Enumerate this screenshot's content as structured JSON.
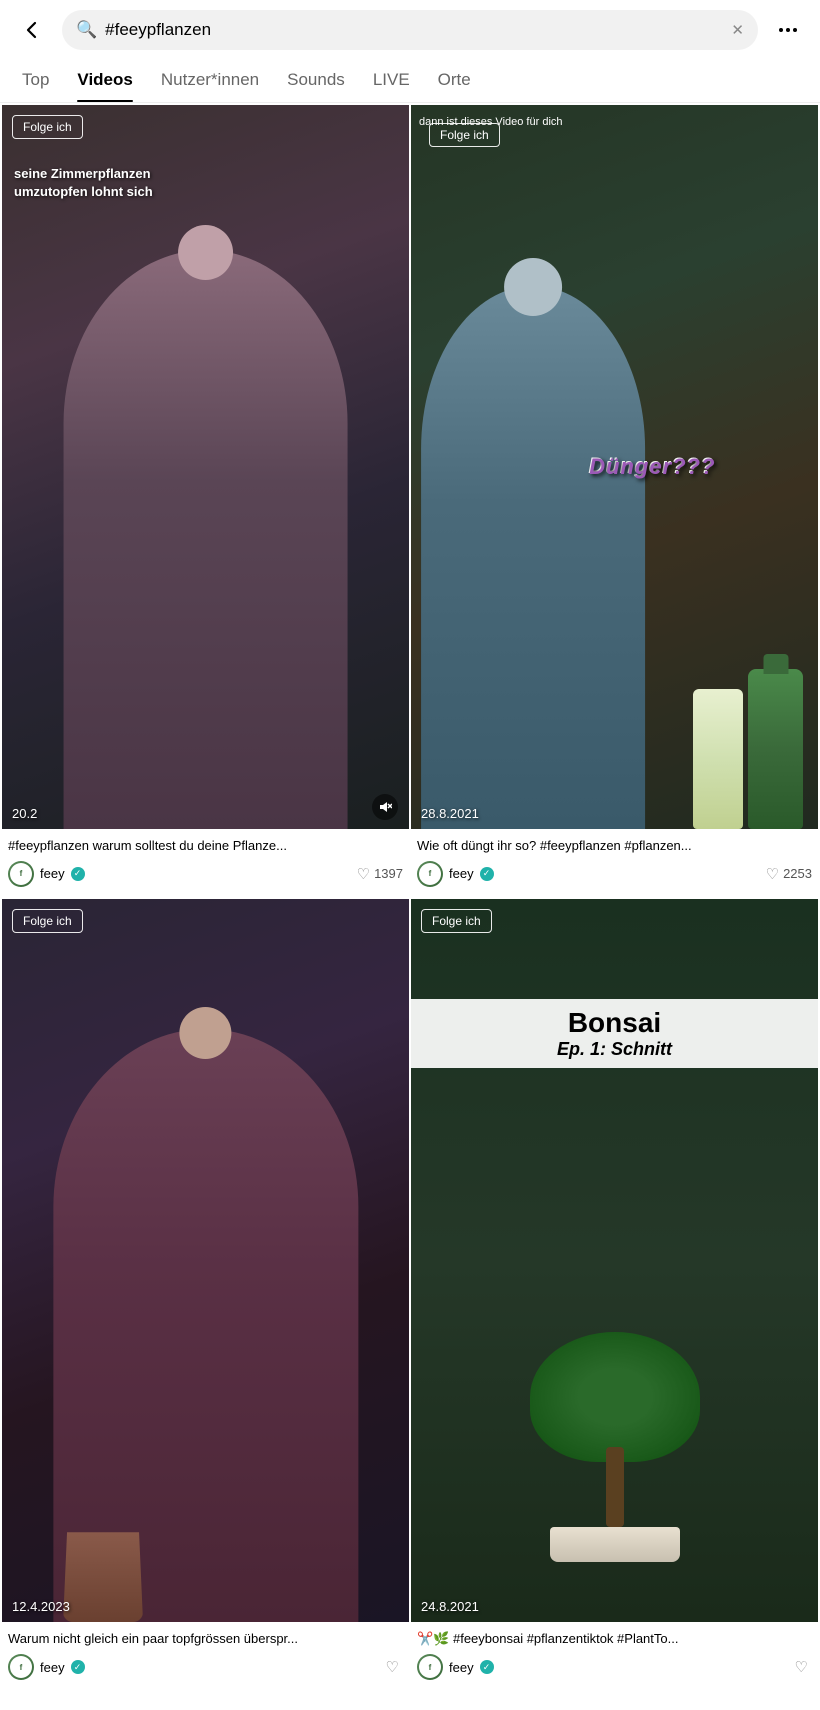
{
  "header": {
    "search_query": "#feeypflanzen",
    "back_label": "back",
    "clear_label": "clear",
    "more_label": "more"
  },
  "tabs": [
    {
      "id": "top",
      "label": "Top",
      "active": false
    },
    {
      "id": "videos",
      "label": "Videos",
      "active": true
    },
    {
      "id": "nutzerinnen",
      "label": "Nutzer*innen",
      "active": false
    },
    {
      "id": "sounds",
      "label": "Sounds",
      "active": false
    },
    {
      "id": "live",
      "label": "LIVE",
      "active": false
    },
    {
      "id": "orte",
      "label": "Orte",
      "active": false
    }
  ],
  "videos": [
    {
      "id": "v1",
      "timestamp": "20.2",
      "caption": "#feeypflanzen warum solltest du deine Pflanze...",
      "text_overlay_line1": "seine Zimmerpflanzen",
      "text_overlay_line2": "umzutopfen lohnt sich",
      "follow_label": "Folge ich",
      "author": "feey",
      "likes": "1397",
      "has_mute": true
    },
    {
      "id": "v2",
      "timestamp": "28.8.2021",
      "caption": "Wie oft düngt ihr so? #feeypflanzen #pflanzen...",
      "dunger_text": "Dünger???",
      "follow_label": "Folge ich",
      "follow_sub": "dann ist dieses Video für dich",
      "author": "feey",
      "likes": "2253",
      "has_mute": false
    },
    {
      "id": "v3",
      "timestamp": "12.4.2023",
      "caption": "Warum nicht gleich ein paar topfgrössen überspr...",
      "follow_label": "Folge ich",
      "author": "feey",
      "likes": "",
      "has_mute": false
    },
    {
      "id": "v4",
      "timestamp": "24.8.2021",
      "caption": "✂️🌿 #feeybonsai #pflanzentiktok #PlantTo...",
      "bonsai_title": "Bonsai",
      "bonsai_subtitle": "Ep. 1: Schnitt",
      "follow_label": "Folge ich",
      "author": "feey",
      "likes": "",
      "has_mute": false
    }
  ],
  "icons": {
    "back": "←",
    "search": "🔍",
    "clear": "✕",
    "more": "•••",
    "verified": "✓",
    "heart": "♡",
    "mute": "🔇"
  }
}
